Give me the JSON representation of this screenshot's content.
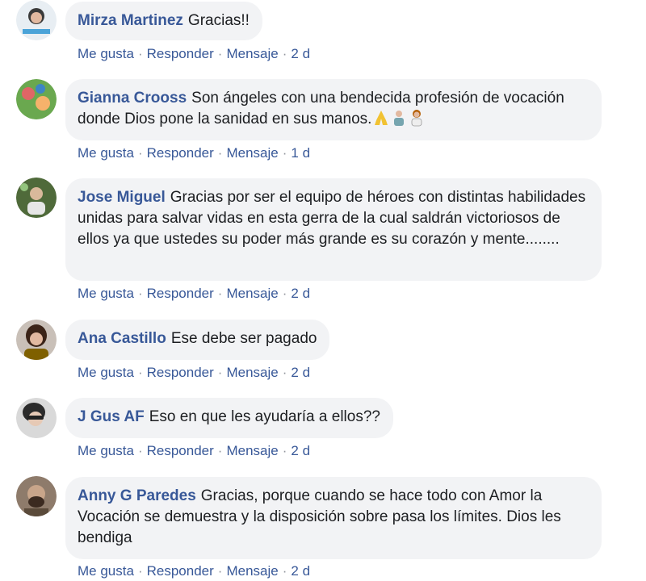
{
  "actions": {
    "like": "Me gusta",
    "reply": "Responder",
    "message": "Mensaje",
    "separator": "·"
  },
  "comments": [
    {
      "author": "Mirza Martinez",
      "text": "Gracias!!",
      "time": "2 d"
    },
    {
      "author": "Gianna Crooss",
      "text": "Son ángeles con una bendecida profesión de vocación donde Dios pone la sanidad en sus manos.",
      "time": "1 d",
      "emojis": [
        "folded-hands",
        "health-worker",
        "health-worker-woman"
      ]
    },
    {
      "author": "Jose Miguel",
      "text": "Gracias por ser el equipo de héroes con distintas habilidades unidas para salvar vidas en esta gerra de la cual saldrán victoriosos de ellos ya que ustedes su poder más grande es su corazón y mente........",
      "time": "2 d"
    },
    {
      "author": "Ana Castillo",
      "text": "Ese debe ser pagado",
      "time": "2 d"
    },
    {
      "author": "J Gus AF",
      "text": "Eso en que les ayudaría a ellos??",
      "time": "2 d"
    },
    {
      "author": "Anny G Paredes",
      "text": "Gracias, porque cuando se hace todo con Amor la Vocación se demuestra y la disposición sobre pasa los límites. Dios les bendiga",
      "time": "2 d"
    }
  ],
  "colors": {
    "link": "#385898",
    "bubble": "#f2f3f5",
    "text": "#1c1e21"
  }
}
